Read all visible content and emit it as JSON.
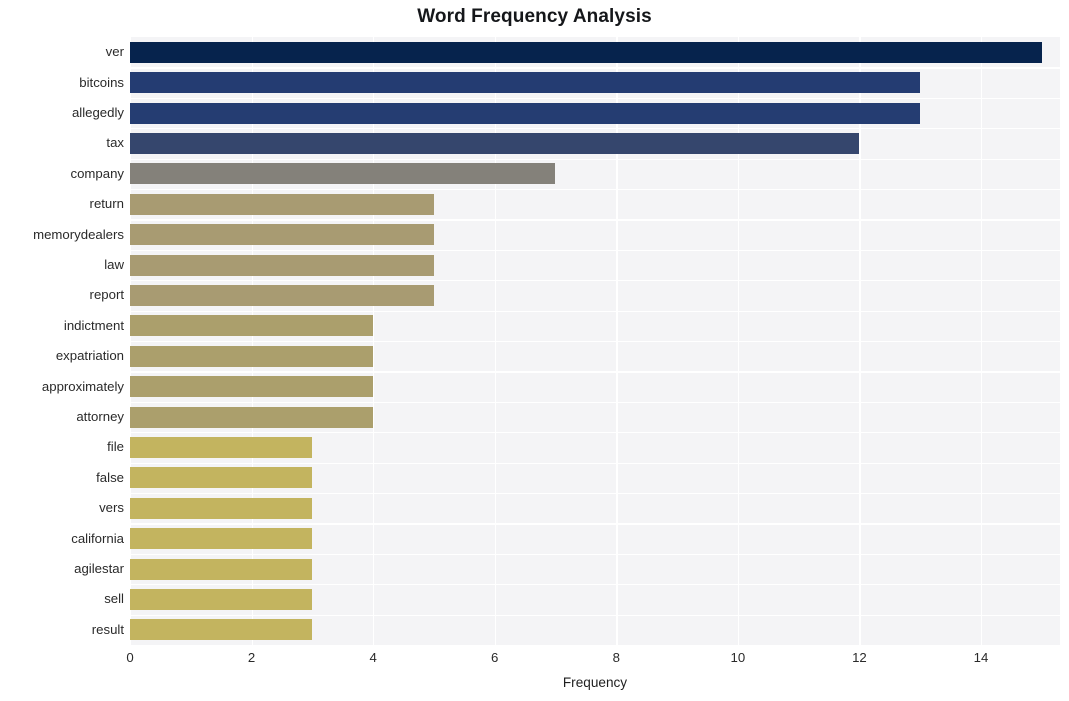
{
  "chart_data": {
    "type": "bar",
    "orientation": "horizontal",
    "title": "Word Frequency Analysis",
    "xlabel": "Frequency",
    "ylabel": "",
    "xlim": [
      0,
      15.3
    ],
    "xticks": [
      0,
      2,
      4,
      6,
      8,
      10,
      12,
      14
    ],
    "xtick_labels": [
      "0",
      "2",
      "4",
      "6",
      "8",
      "10",
      "12",
      "14"
    ],
    "grid": true,
    "legend": "none",
    "background": "#f4f4f6",
    "categories": [
      "ver",
      "bitcoins",
      "allegedly",
      "tax",
      "company",
      "return",
      "memorydealers",
      "law",
      "report",
      "indictment",
      "expatriation",
      "approximately",
      "attorney",
      "file",
      "false",
      "vers",
      "california",
      "agilestar",
      "sell",
      "result"
    ],
    "values": [
      15,
      13,
      13,
      12,
      7,
      5,
      5,
      5,
      5,
      4,
      4,
      4,
      4,
      3,
      3,
      3,
      3,
      3,
      3,
      3
    ],
    "bar_colors": [
      "#06234d",
      "#243c72",
      "#253d72",
      "#35466d",
      "#84817a",
      "#a89b72",
      "#a89b72",
      "#a89b72",
      "#a89b72",
      "#ab9f6c",
      "#ab9f6c",
      "#ab9f6c",
      "#ab9f6c",
      "#c3b45f",
      "#c3b45f",
      "#c3b45f",
      "#c3b45f",
      "#c3b45f",
      "#c3b45f",
      "#c3b45f"
    ]
  }
}
